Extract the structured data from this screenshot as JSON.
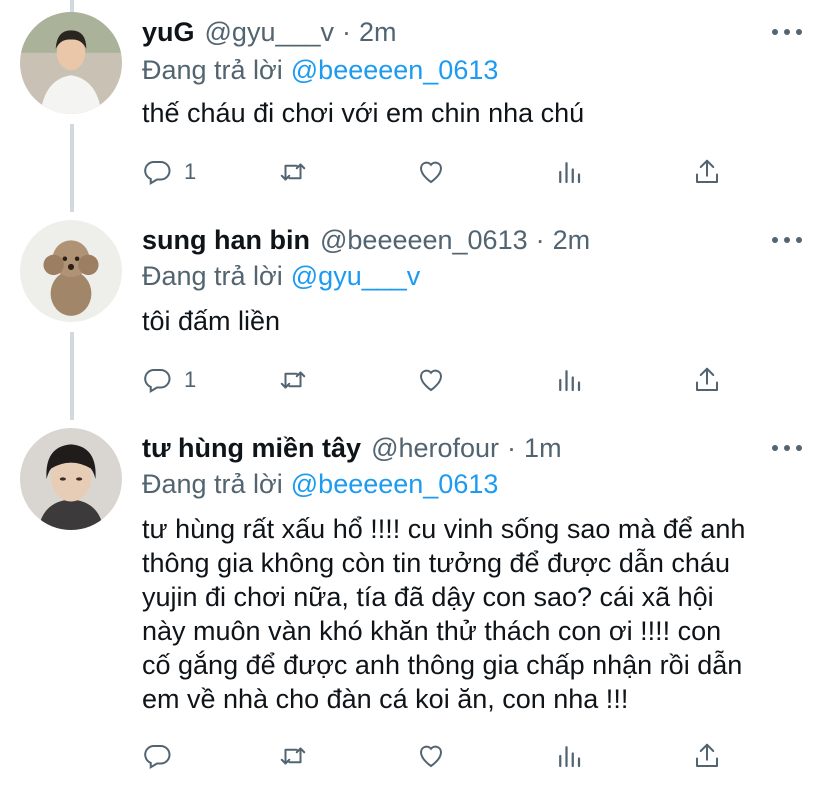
{
  "colors": {
    "text": "#0f1419",
    "muted": "#536471",
    "accent": "#1d9bf0",
    "thread": "#cfd9de"
  },
  "tweets": [
    {
      "name": "yuG",
      "handle": "@gyu___v",
      "dot": "·",
      "time": "2m",
      "replying_label": "Đang trả lời",
      "replying_to": "@beeeeen_0613",
      "text": "thế cháu đi chơi với em chin nha chú",
      "reply_count": "1",
      "avatar": "avatar-man-white-shirt"
    },
    {
      "name": "sung han bin",
      "handle": "@beeeeen_0613",
      "dot": "·",
      "time": "2m",
      "replying_label": "Đang trả lời",
      "replying_to": "@gyu___v",
      "text": "tôi đấm liền",
      "reply_count": "1",
      "avatar": "avatar-poodle"
    },
    {
      "name": "tư hùng miền tây",
      "handle": "@herofour",
      "dot": "·",
      "time": "1m",
      "replying_label": "Đang trả lời",
      "replying_to": "@beeeeen_0613",
      "text_lines": [
        "tư hùng rất xấu hổ !!!! cu vinh sống sao mà để anh",
        "thông gia không còn tin tưởng để được dẫn cháu",
        "yujin đi chơi nữa, tía đã dậy con sao? cái xã hội",
        "này muôn vàn khó khăn thử thách con ơi !!!! con",
        "cố gắng để được anh thông gia chấp nhận rồi dẫn",
        "em về nhà cho đàn cá koi ăn, con nha !!!"
      ],
      "reply_count": "",
      "avatar": "avatar-boy-hair"
    }
  ],
  "icons": [
    "reply-icon",
    "retweet-icon",
    "like-icon",
    "analytics-icon",
    "share-icon",
    "more-icon"
  ]
}
